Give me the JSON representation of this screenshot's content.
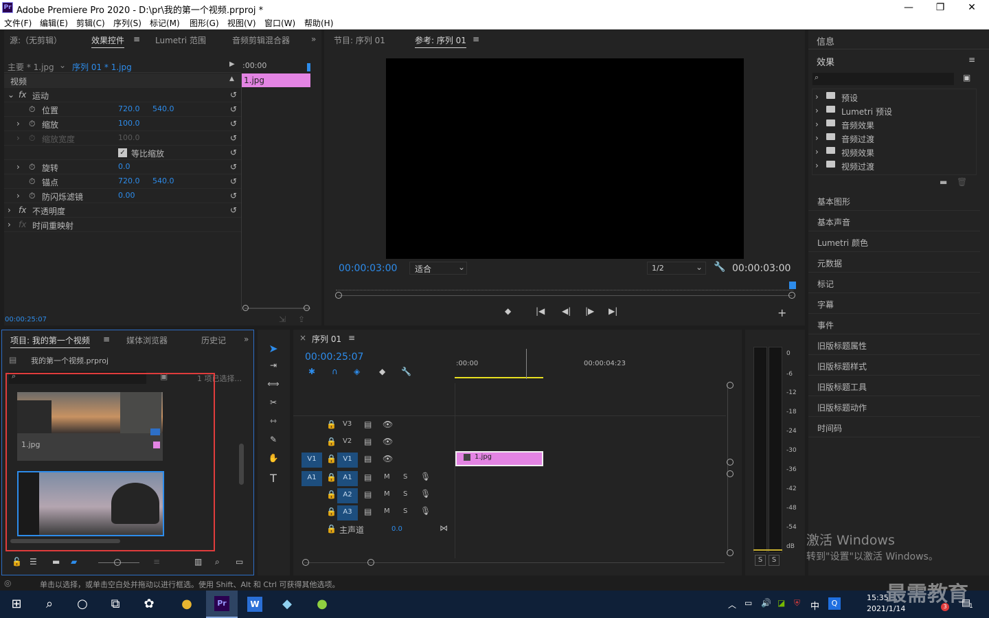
{
  "window": {
    "title": "Adobe Premiere Pro 2020 - D:\\pr\\我的第一个视频.prproj *",
    "logo": "Pr",
    "min": "—",
    "max": "❐",
    "close": "✕"
  },
  "menu": [
    "文件(F)",
    "编辑(E)",
    "剪辑(C)",
    "序列(S)",
    "标记(M)",
    "图形(G)",
    "视图(V)",
    "窗口(W)",
    "帮助(H)"
  ],
  "source_panel": {
    "tabs": [
      "源:（无剪辑）",
      "效果控件",
      "Lumetri 范围",
      "音频剪辑混合器"
    ],
    "master_label": "主要 * 1.jpg",
    "sequence_label": "序列 01 * 1.jpg",
    "timecode_start": ":00:00",
    "clip_label": "1.jpg",
    "video_label": "视频",
    "motion": "运动",
    "position": {
      "label": "位置",
      "x": "720.0",
      "y": "540.0"
    },
    "scale": {
      "label": "缩放",
      "value": "100.0"
    },
    "scale_width": {
      "label": "缩放宽度",
      "value": "100.0"
    },
    "uniform": "等比缩放",
    "rotation": {
      "label": "旋转",
      "value": "0.0"
    },
    "anchor": {
      "label": "锚点",
      "x": "720.0",
      "y": "540.0"
    },
    "flicker": {
      "label": "防闪烁滤镜",
      "value": "0.00"
    },
    "opacity": "不透明度",
    "time_remap": "时间重映射",
    "fx": "fx",
    "bottom_timecode": "00:00:25:07"
  },
  "program_monitor": {
    "tabs": [
      "节目: 序列 01",
      "参考: 序列 01"
    ],
    "timecode_left": "00:00:03:00",
    "fit": "适合",
    "resolution": "1/2",
    "timecode_right": "00:00:03:00",
    "add": "+"
  },
  "right_panel": {
    "info": "信息",
    "effects": "效果",
    "effects_items": [
      "预设",
      "Lumetri 预设",
      "音频效果",
      "音频过渡",
      "视频效果",
      "视频过渡"
    ],
    "list": [
      "基本图形",
      "基本声音",
      "Lumetri 颜色",
      "元数据",
      "标记",
      "字幕",
      "事件",
      "旧版标题属性",
      "旧版标题样式",
      "旧版标题工具",
      "旧版标题动作",
      "时间码"
    ],
    "watermark_title": "激活 Windows",
    "watermark_sub": "转到\"设置\"以激活 Windows。"
  },
  "project_panel": {
    "tabs": [
      "项目: 我的第一个视频",
      "媒体浏览器",
      "历史记"
    ],
    "project_file": "我的第一个视频.prproj",
    "selected": "1 项已选择...",
    "item1": "1.jpg",
    "highlight_color": "#e03c3c"
  },
  "timeline": {
    "tab": "序列 01",
    "timecode": "00:00:25:07",
    "ruler_start": ":00:00",
    "ruler_mid": "00:00:04:23",
    "tracks": [
      "V3",
      "V2",
      "V1",
      "A1",
      "A2",
      "A3"
    ],
    "master": "主声道",
    "master_value": "0.0",
    "clip": "1.jpg",
    "src_v": "V1",
    "src_a": "A1",
    "m": "M",
    "s": "S"
  },
  "meter": {
    "labels": [
      "0",
      "-6",
      "-12",
      "-18",
      "-24",
      "-30",
      "-36",
      "-42",
      "-48",
      "-54",
      "dB"
    ],
    "s": "S"
  },
  "status": {
    "text": "单击以选择，或单击空白处并拖动以进行框选。使用 Shift、Alt 和 Ctrl 可获得其他选项。"
  },
  "taskbar": {
    "time": "15:35",
    "date": "2021/1/14",
    "ime": "中",
    "badge": "3",
    "brand": "最需教育",
    "notif": "1"
  }
}
